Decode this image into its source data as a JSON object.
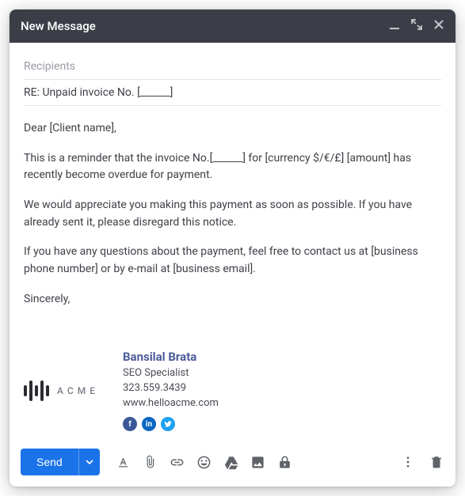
{
  "titlebar": {
    "title": "New Message"
  },
  "fields": {
    "recipients_placeholder": "Recipients",
    "subject": "RE: Unpaid  invoice No. [______]"
  },
  "body": {
    "p1": "Dear [Client name],",
    "p2": "This is a reminder that the invoice No.[______] for [currency $/€/£] [amount] has recently become overdue for payment.",
    "p3": "We would appreciate you making this payment as soon as possible. If you have already sent it, please disregard this notice.",
    "p4": "If you have any questions about the payment, feel free to contact us at [business phone number] or by e-mail at [business email].",
    "p5": "Sincerely,"
  },
  "signature": {
    "brand": "ACME",
    "name": "Bansilal Brata",
    "role": "SEO Specialist",
    "phone": "323.559.3439",
    "website": "www.helloacme.com"
  },
  "toolbar": {
    "send_label": "Send"
  }
}
